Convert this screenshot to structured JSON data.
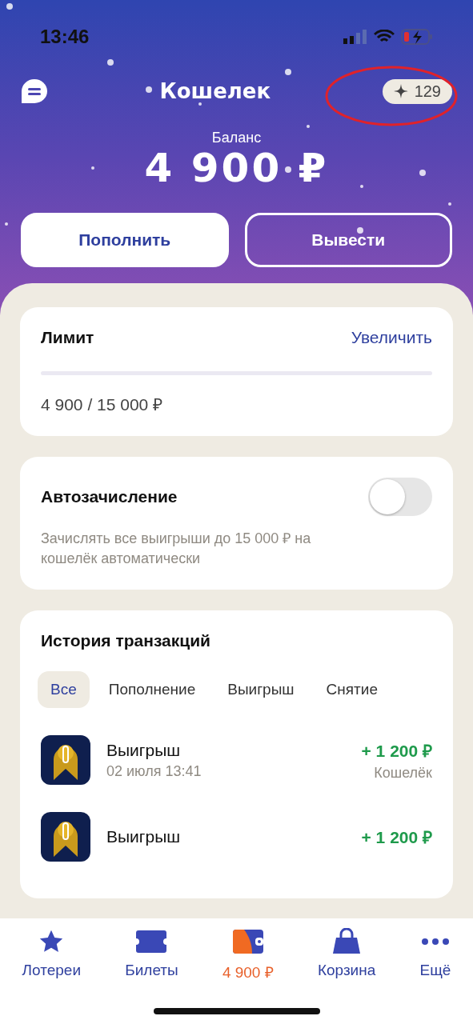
{
  "status_bar": {
    "time": "13:46"
  },
  "header": {
    "title": "Кошелек",
    "points": "129",
    "balance_label": "Баланс",
    "balance": "4 900 ₽"
  },
  "actions": [
    {
      "label": "Пополнить",
      "kind": "filled"
    },
    {
      "label": "Вывести",
      "kind": "outline"
    }
  ],
  "limit": {
    "title": "Лимит",
    "link": "Увеличить",
    "level": 0,
    "reading": "4 900 / 15 000 ₽"
  },
  "auto_credit": {
    "title": "Автозачисление",
    "on": false,
    "description": "Зачислять все выигрыши до 15 000 ₽ на кошелёк автоматически"
  },
  "history": {
    "title": "История транзакций",
    "filters": [
      {
        "label": "Все",
        "selected": true
      },
      {
        "label": "Пополнение",
        "selected": false
      },
      {
        "label": "Выигрыш",
        "selected": false
      },
      {
        "label": "Снятие",
        "selected": false
      }
    ],
    "transactions": [
      {
        "title": "Выигрыш",
        "date": "02 июля 13:41",
        "amount": "+ 1 200 ₽",
        "account": "Кошелёк"
      },
      {
        "title": "Выигрыш",
        "amount": "+ 1 200 ₽"
      }
    ]
  },
  "tab_bar": [
    {
      "label": "Лотереи",
      "kind": "star",
      "selected": false
    },
    {
      "label": "Билеты",
      "kind": "ticket",
      "selected": false
    },
    {
      "label": "4 900 ₽",
      "kind": "wallet",
      "selected": true
    },
    {
      "label": "Корзина",
      "kind": "bag",
      "selected": false
    },
    {
      "label": "Ещё",
      "kind": "more",
      "selected": false
    }
  ]
}
